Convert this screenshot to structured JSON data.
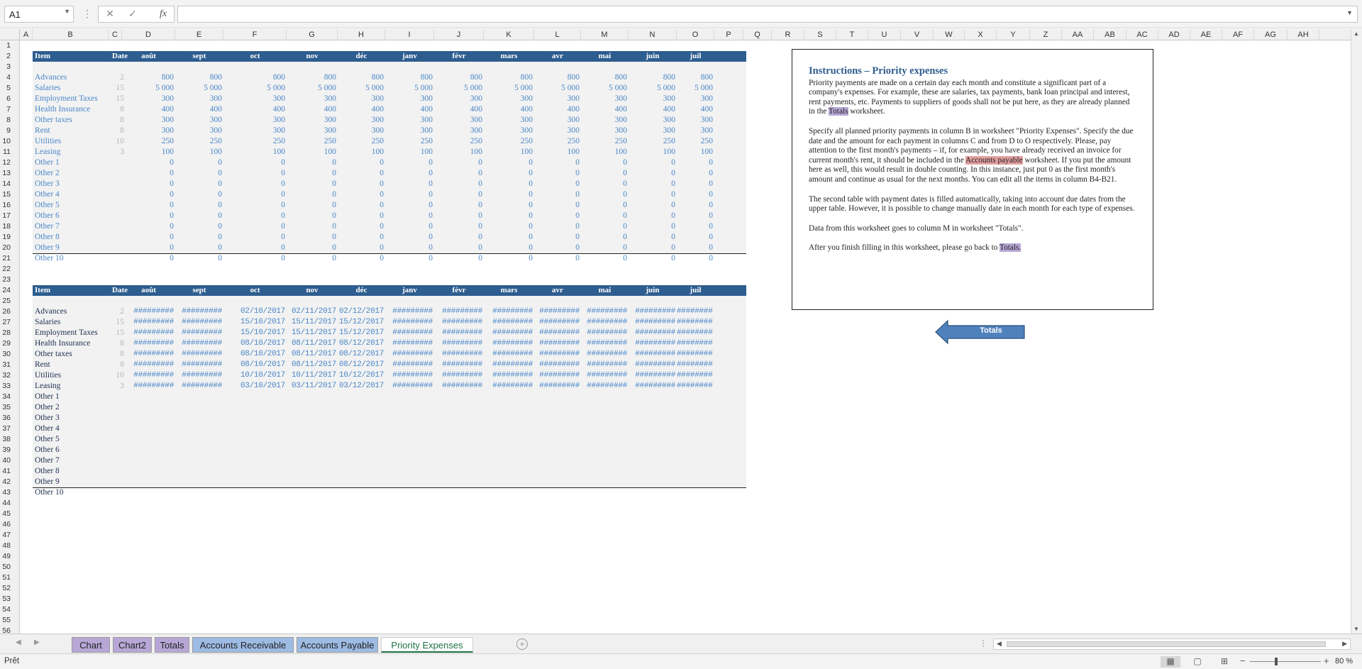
{
  "formula_bar": {
    "name_box": "A1",
    "fx": "fx",
    "formula": ""
  },
  "columns": [
    "A",
    "B",
    "C",
    "D",
    "E",
    "F",
    "G",
    "H",
    "I",
    "J",
    "K",
    "L",
    "M",
    "N",
    "O",
    "P",
    "Q",
    "R",
    "S",
    "T",
    "U",
    "V",
    "W",
    "X",
    "Y",
    "Z",
    "AA",
    "AB",
    "AC",
    "AD",
    "AE",
    "AF",
    "AG",
    "AH"
  ],
  "rows": [
    "1",
    "2",
    "3",
    "4",
    "5",
    "6",
    "7",
    "8",
    "9",
    "10",
    "11",
    "12",
    "13",
    "14",
    "15",
    "16",
    "17",
    "18",
    "19",
    "20",
    "21",
    "22",
    "23",
    "24",
    "25",
    "26",
    "27",
    "28",
    "29",
    "30",
    "31",
    "32",
    "33",
    "34",
    "35",
    "36",
    "37",
    "38",
    "39",
    "40",
    "41",
    "42",
    "43",
    "44",
    "45",
    "46",
    "47",
    "48",
    "49",
    "50",
    "51",
    "52",
    "53",
    "54",
    "55",
    "56"
  ],
  "table_headers": [
    "Item",
    "Date",
    "août",
    "sept",
    "oct",
    "nov",
    "déc",
    "janv",
    "févr",
    "mars",
    "avr",
    "mai",
    "juin",
    "juil"
  ],
  "amounts_table": [
    {
      "item": "Advances",
      "date": "2",
      "values": [
        "800",
        "800",
        "800",
        "800",
        "800",
        "800",
        "800",
        "800",
        "800",
        "800",
        "800",
        "800"
      ]
    },
    {
      "item": "Salaries",
      "date": "15",
      "values": [
        "5 000",
        "5 000",
        "5 000",
        "5 000",
        "5 000",
        "5 000",
        "5 000",
        "5 000",
        "5 000",
        "5 000",
        "5 000",
        "5 000"
      ]
    },
    {
      "item": "Employment Taxes",
      "date": "15",
      "values": [
        "300",
        "300",
        "300",
        "300",
        "300",
        "300",
        "300",
        "300",
        "300",
        "300",
        "300",
        "300"
      ]
    },
    {
      "item": "Health Insurance",
      "date": "8",
      "values": [
        "400",
        "400",
        "400",
        "400",
        "400",
        "400",
        "400",
        "400",
        "400",
        "400",
        "400",
        "400"
      ]
    },
    {
      "item": "Other taxes",
      "date": "8",
      "values": [
        "300",
        "300",
        "300",
        "300",
        "300",
        "300",
        "300",
        "300",
        "300",
        "300",
        "300",
        "300"
      ]
    },
    {
      "item": "Rent",
      "date": "8",
      "values": [
        "300",
        "300",
        "300",
        "300",
        "300",
        "300",
        "300",
        "300",
        "300",
        "300",
        "300",
        "300"
      ]
    },
    {
      "item": "Utilities",
      "date": "10",
      "values": [
        "250",
        "250",
        "250",
        "250",
        "250",
        "250",
        "250",
        "250",
        "250",
        "250",
        "250",
        "250"
      ]
    },
    {
      "item": "Leasing",
      "date": "3",
      "values": [
        "100",
        "100",
        "100",
        "100",
        "100",
        "100",
        "100",
        "100",
        "100",
        "100",
        "100",
        "100"
      ]
    },
    {
      "item": "Other 1",
      "date": "",
      "values": [
        "0",
        "0",
        "0",
        "0",
        "0",
        "0",
        "0",
        "0",
        "0",
        "0",
        "0",
        "0"
      ]
    },
    {
      "item": "Other 2",
      "date": "",
      "values": [
        "0",
        "0",
        "0",
        "0",
        "0",
        "0",
        "0",
        "0",
        "0",
        "0",
        "0",
        "0"
      ]
    },
    {
      "item": "Other 3",
      "date": "",
      "values": [
        "0",
        "0",
        "0",
        "0",
        "0",
        "0",
        "0",
        "0",
        "0",
        "0",
        "0",
        "0"
      ]
    },
    {
      "item": "Other 4",
      "date": "",
      "values": [
        "0",
        "0",
        "0",
        "0",
        "0",
        "0",
        "0",
        "0",
        "0",
        "0",
        "0",
        "0"
      ]
    },
    {
      "item": "Other 5",
      "date": "",
      "values": [
        "0",
        "0",
        "0",
        "0",
        "0",
        "0",
        "0",
        "0",
        "0",
        "0",
        "0",
        "0"
      ]
    },
    {
      "item": "Other 6",
      "date": "",
      "values": [
        "0",
        "0",
        "0",
        "0",
        "0",
        "0",
        "0",
        "0",
        "0",
        "0",
        "0",
        "0"
      ]
    },
    {
      "item": "Other 7",
      "date": "",
      "values": [
        "0",
        "0",
        "0",
        "0",
        "0",
        "0",
        "0",
        "0",
        "0",
        "0",
        "0",
        "0"
      ]
    },
    {
      "item": "Other 8",
      "date": "",
      "values": [
        "0",
        "0",
        "0",
        "0",
        "0",
        "0",
        "0",
        "0",
        "0",
        "0",
        "0",
        "0"
      ]
    },
    {
      "item": "Other 9",
      "date": "",
      "values": [
        "0",
        "0",
        "0",
        "0",
        "0",
        "0",
        "0",
        "0",
        "0",
        "0",
        "0",
        "0"
      ]
    },
    {
      "item": "Other 10",
      "date": "",
      "values": [
        "0",
        "0",
        "0",
        "0",
        "0",
        "0",
        "0",
        "0",
        "0",
        "0",
        "0",
        "0"
      ]
    }
  ],
  "dates_table": [
    {
      "item": "Advances",
      "date": "2",
      "values": [
        "#########",
        "#########",
        "02/10/2017",
        "02/11/2017",
        "02/12/2017",
        "#########",
        "#########",
        "#########",
        "#########",
        "#########",
        "#########",
        "#########"
      ]
    },
    {
      "item": "Salaries",
      "date": "15",
      "values": [
        "#########",
        "#########",
        "15/10/2017",
        "15/11/2017",
        "15/12/2017",
        "#########",
        "#########",
        "#########",
        "#########",
        "#########",
        "#########",
        "#########"
      ]
    },
    {
      "item": "Employment Taxes",
      "date": "15",
      "values": [
        "#########",
        "#########",
        "15/10/2017",
        "15/11/2017",
        "15/12/2017",
        "#########",
        "#########",
        "#########",
        "#########",
        "#########",
        "#########",
        "#########"
      ]
    },
    {
      "item": "Health Insurance",
      "date": "8",
      "values": [
        "#########",
        "#########",
        "08/10/2017",
        "08/11/2017",
        "08/12/2017",
        "#########",
        "#########",
        "#########",
        "#########",
        "#########",
        "#########",
        "#########"
      ]
    },
    {
      "item": "Other taxes",
      "date": "8",
      "values": [
        "#########",
        "#########",
        "08/10/2017",
        "08/11/2017",
        "08/12/2017",
        "#########",
        "#########",
        "#########",
        "#########",
        "#########",
        "#########",
        "#########"
      ]
    },
    {
      "item": "Rent",
      "date": "8",
      "values": [
        "#########",
        "#########",
        "08/10/2017",
        "08/11/2017",
        "08/12/2017",
        "#########",
        "#########",
        "#########",
        "#########",
        "#########",
        "#########",
        "#########"
      ]
    },
    {
      "item": "Utilities",
      "date": "10",
      "values": [
        "#########",
        "#########",
        "10/10/2017",
        "10/11/2017",
        "10/12/2017",
        "#########",
        "#########",
        "#########",
        "#########",
        "#########",
        "#########",
        "#########"
      ]
    },
    {
      "item": "Leasing",
      "date": "3",
      "values": [
        "#########",
        "#########",
        "03/10/2017",
        "03/11/2017",
        "03/12/2017",
        "#########",
        "#########",
        "#########",
        "#########",
        "#########",
        "#########",
        "#########"
      ]
    },
    {
      "item": "Other 1",
      "date": "",
      "values": []
    },
    {
      "item": "Other 2",
      "date": "",
      "values": []
    },
    {
      "item": "Other 3",
      "date": "",
      "values": []
    },
    {
      "item": "Other 4",
      "date": "",
      "values": []
    },
    {
      "item": "Other 5",
      "date": "",
      "values": []
    },
    {
      "item": "Other 6",
      "date": "",
      "values": []
    },
    {
      "item": "Other 7",
      "date": "",
      "values": []
    },
    {
      "item": "Other 8",
      "date": "",
      "values": []
    },
    {
      "item": "Other 9",
      "date": "",
      "values": []
    },
    {
      "item": "Other 10",
      "date": "",
      "values": []
    }
  ],
  "instructions": {
    "title": "Instructions – Priority expenses",
    "p1_a": "Priority payments are made on a certain day each month and constitute a significant part of a company's expenses. For example, these are salaries, tax payments, bank loan principal and interest, rent payments, etc. Payments to suppliers of goods shall not be put here, as they are already planned in the ",
    "p1_link": "Totals",
    "p1_b": " worksheet.",
    "p2_a": "Specify all planned priority payments in column B in worksheet \"Priority Expenses\". Specify the due date and the amount for each payment in columns C and from D to O  respectively. Please, pay attention to the first month's payments – if, for example, you have already received an invoice for current month's rent, it should be included in the ",
    "p2_link": "Accounts payable",
    "p2_b": " worksheet. If you put the amount here as well, this would result in double counting. In this instance, just put 0 as the first month's amount and continue as usual for the next months. You can edit all the items in column B4-B21.",
    "p3": "The second table with payment dates is filled automatically, taking into account due dates from the upper table. However, it is possible to change manually date in each month for each type of expenses.",
    "p4": "Data from this worksheet goes to column M in worksheet \"Totals\".",
    "p5_a": "After you finish filling in this worksheet, please go back to ",
    "p5_link": "Totals."
  },
  "back_button": {
    "label": "Totals"
  },
  "tabs": [
    {
      "label": "Chart",
      "color": "#b8a7d6"
    },
    {
      "label": "Chart2",
      "color": "#b8a7d6"
    },
    {
      "label": "Totals",
      "color": "#b8a7d6"
    },
    {
      "label": "Accounts Receivable",
      "color": "#9dbbe3"
    },
    {
      "label": "Accounts Payable",
      "color": "#9dbbe3"
    },
    {
      "label": "Priority Expenses",
      "color": "#ffffff",
      "active": true
    }
  ],
  "status": {
    "text": "Prêt",
    "zoom": "80 %"
  },
  "colors": {
    "header_bg": "#2e5d8f",
    "value_blue": "#4a86c8",
    "date_grey": "#b4b4b4",
    "active_tab": "#1e7145"
  }
}
